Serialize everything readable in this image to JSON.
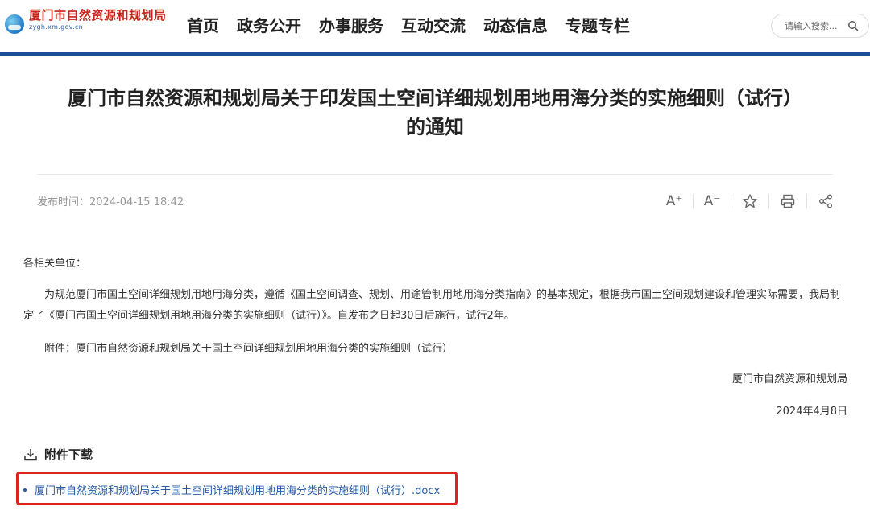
{
  "site": {
    "name": "厦门市自然资源和规划局",
    "domain": "zygh.xm.gov.cn"
  },
  "nav": {
    "items": [
      {
        "label": "首页"
      },
      {
        "label": "政务公开"
      },
      {
        "label": "办事服务"
      },
      {
        "label": "互动交流"
      },
      {
        "label": "动态信息"
      },
      {
        "label": "专题专栏"
      }
    ]
  },
  "search": {
    "placeholder": "请输入搜索..."
  },
  "article": {
    "title_line1": "厦门市自然资源和规划局关于印发国土空间详细规划用地用海分类的实施细则（试行）",
    "title_line2": "的通知",
    "publish_label": "发布时间：",
    "publish_time": "2024-04-15 18:42",
    "tools": {
      "font_larger": "A⁺",
      "font_smaller": "A⁻",
      "favorite_icon": "star-icon",
      "print_icon": "printer-icon",
      "share_icon": "share-icon"
    },
    "addressee": "各相关单位：",
    "para1": "为规范厦门市国土空间详细规划用地用海分类，遵循《国土空间调查、规划、用途管制用地用海分类指南》的基本规定，根据我市国土空间规划建设和管理实际需要，我局制定了《厦门市国土空间详细规划用地用海分类的实施细则（试行）》。自发布之日起30日后施行，试行2年。",
    "para2": "附件：厦门市自然资源和规划局关于国土空间详细规划用地用海分类的实施细则（试行）",
    "sign_org": "厦门市自然资源和规划局",
    "sign_date": "2024年4月8日"
  },
  "attachments": {
    "heading": "附件下载",
    "items": [
      {
        "name": "厦门市自然资源和规划局关于国土空间详细规划用地用海分类的实施细则（试行）.docx"
      }
    ]
  },
  "colors": {
    "brand_blue": "#1a4f99",
    "logo_red": "#c8251d",
    "link_blue": "#2459a7",
    "highlight_red": "#e0221a"
  }
}
